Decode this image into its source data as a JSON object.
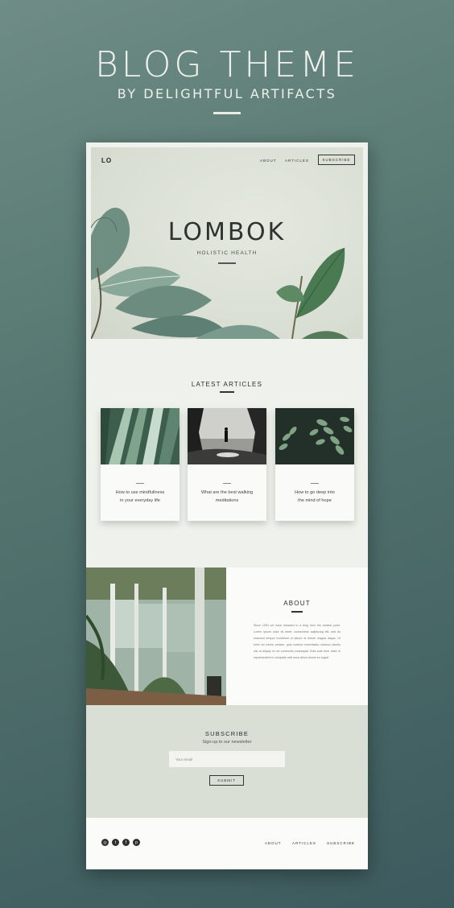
{
  "banner": {
    "title": "BLOG THEME",
    "subtitle": "BY DELIGHTFUL ARTIFACTS"
  },
  "site": {
    "logo": "LO",
    "nav": {
      "about": "ABOUT",
      "articles": "ARTICLES",
      "subscribe": "SUBSCRIBE"
    }
  },
  "hero": {
    "title": "LOMBOK",
    "subtitle": "HOLISTIC HEALTH"
  },
  "articles": {
    "heading": "LATEST ARTICLES",
    "items": [
      {
        "line1": "How to use mindfullness",
        "line2": "in your everyday life"
      },
      {
        "line1": "What are the best walking",
        "line2": "meditations"
      },
      {
        "line1": "How to go deep into",
        "line2": "the mind of hope"
      }
    ]
  },
  "about": {
    "heading": "ABOUT",
    "body": "Since 1994 we have released in a blog from the earliest point. Lorem ipsum dolor sit amet, consectetur adipiscing elit, sed do eiusmod tempor incididunt ut labore et dolore magna aliqua. Ut enim ad minim veniam, quis nostrud exercitation ullamco laboris nisi ut aliquip ex ea commodo consequat. Duis aute irure dolor in reprehenderit in voluptate velit esse cillum dolore eu fugiat."
  },
  "subscribe": {
    "heading": "SUBSCRIBE",
    "text": "Sign-up to our newsletter",
    "placeholder": "Your email",
    "button": "SUBMIT"
  },
  "footer": {
    "social": [
      "instagram-icon",
      "twitter-icon",
      "facebook-icon",
      "pinterest-icon"
    ],
    "nav": {
      "about": "ABOUT",
      "articles": "ARTICLES",
      "subscribe": "SUBSCRIBE"
    }
  }
}
